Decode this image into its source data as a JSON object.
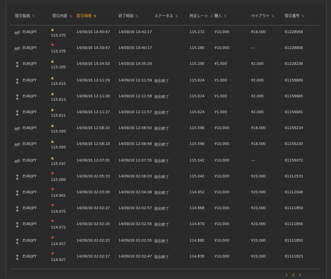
{
  "table": {
    "headers": [
      {
        "label": "取引銘柄",
        "active": false
      },
      {
        "label": "取引内容",
        "active": false
      },
      {
        "label": "取引時間",
        "active": true
      },
      {
        "label": "終了時刻",
        "active": false
      },
      {
        "label": "ステータス",
        "active": false
      },
      {
        "label": "判定レート",
        "active": false
      },
      {
        "label": "購入",
        "active": false
      },
      {
        "label": "ペイアウト",
        "active": false
      },
      {
        "label": "取引番号",
        "active": false
      }
    ],
    "rows": [
      {
        "type": "spread",
        "pair": "EUR/JPY",
        "dir": "up",
        "rate": "115.270",
        "start": "14/09/16 19:40:47",
        "end": "14/09/16 19:41:17",
        "status": "",
        "judge": "115.272",
        "buy": "¥10,000",
        "payout": "¥18,000",
        "id": "61228958"
      },
      {
        "type": "spread",
        "pair": "EUR/JPY",
        "dir": "down",
        "rate": "115.276",
        "start": "14/09/16 19:39:47",
        "end": "14/09/16 19:40:17",
        "status": "",
        "judge": "115.280",
        "buy": "¥10,000",
        "payout": "---",
        "id": "61228808"
      },
      {
        "type": "hourglass",
        "pair": "EUR/JPY",
        "dir": "up",
        "rate": "115.285",
        "start": "14/09/16 19:34:59",
        "end": "14/09/16 19:35:29",
        "status": "",
        "judge": "115.290",
        "buy": "¥1,000",
        "payout": "¥2,000",
        "id": "61228236"
      },
      {
        "type": "hourglass",
        "pair": "EUR/JPY",
        "dir": "up",
        "rate": "115.615",
        "start": "14/09/16 12:11:29",
        "end": "14/09/16 12:11:59",
        "status": "取引終了",
        "judge": "115.624",
        "buy": "¥1,000",
        "payout": "¥2,000",
        "id": "61156689"
      },
      {
        "type": "hourglass",
        "pair": "EUR/JPY",
        "dir": "up",
        "rate": "115.613",
        "start": "14/09/16 12:11:28",
        "end": "14/09/16 12:11:58",
        "status": "取引終了",
        "judge": "115.624",
        "buy": "¥1,000",
        "payout": "¥2,000",
        "id": "61156685"
      },
      {
        "type": "hourglass",
        "pair": "EUR/JPY",
        "dir": "up",
        "rate": "115.611",
        "start": "14/09/16 12:11:27",
        "end": "14/09/16 12:11:57",
        "status": "取引終了",
        "judge": "115.624",
        "buy": "¥1,000",
        "payout": "¥2,000",
        "id": "61156681"
      },
      {
        "type": "spread",
        "pair": "EUR/JPY",
        "dir": "up",
        "rate": "115.583",
        "start": "14/09/16 12:08:20",
        "end": "14/09/16 12:08:50",
        "status": "取引終了",
        "judge": "115.596",
        "buy": "¥10,000",
        "payout": "¥18,000",
        "id": "61156234"
      },
      {
        "type": "spread",
        "pair": "EUR/JPY",
        "dir": "up",
        "rate": "115.583",
        "start": "14/09/16 12:08:18",
        "end": "14/09/16 12:08:48",
        "status": "取引終了",
        "judge": "115.596",
        "buy": "¥10,000",
        "payout": "¥18,000",
        "id": "61156230"
      },
      {
        "type": "spread",
        "pair": "EUR/JPY",
        "dir": "up",
        "rate": "115.547",
        "start": "14/09/16 12:07:05",
        "end": "14/09/16 12:07:35",
        "status": "取引終了",
        "judge": "115.542",
        "buy": "¥10,000",
        "payout": "---",
        "id": "61156072"
      },
      {
        "type": "hourglass",
        "pair": "EUR/JPY",
        "dir": "down",
        "rate": "115.069",
        "start": "14/09/16 02:05:33",
        "end": "14/09/16 02:06:03",
        "status": "取引終了",
        "judge": "115.042",
        "buy": "¥10,000",
        "payout": "¥20,000",
        "id": "61112533"
      },
      {
        "type": "hourglass",
        "pair": "EUR/JPY",
        "dir": "down",
        "rate": "114.961",
        "start": "14/09/16 02:03:38",
        "end": "14/09/16 02:04:08",
        "status": "取引終了",
        "judge": "114.952",
        "buy": "¥10,000",
        "payout": "¥20,000",
        "id": "61112048"
      },
      {
        "type": "hourglass",
        "pair": "EUR/JPY",
        "dir": "down",
        "rate": "114.975",
        "start": "14/09/16 02:02:27",
        "end": "14/09/16 02:02:57",
        "status": "取引終了",
        "judge": "114.868",
        "buy": "¥10,000",
        "payout": "¥20,000",
        "id": "61111859"
      },
      {
        "type": "hourglass",
        "pair": "EUR/JPY",
        "dir": "down",
        "rate": "114.972",
        "start": "14/09/16 02:02:26",
        "end": "14/09/16 02:02:56",
        "status": "取引終了",
        "judge": "114.879",
        "buy": "¥10,000",
        "payout": "¥20,000",
        "id": "61111856"
      },
      {
        "type": "hourglass",
        "pair": "EUR/JPY",
        "dir": "down",
        "rate": "114.957",
        "start": "14/09/16 02:02:25",
        "end": "14/09/16 02:02:55",
        "status": "取引終了",
        "judge": "114.880",
        "buy": "¥10,000",
        "payout": "¥20,000",
        "id": "61111850"
      },
      {
        "type": "hourglass",
        "pair": "EUR/JPY",
        "dir": "down",
        "rate": "114.927",
        "start": "14/09/16 02:02:17",
        "end": "14/09/16 02:02:47",
        "status": "取引終了",
        "judge": "114.838",
        "buy": "¥10,000",
        "payout": "¥20,000",
        "id": "61111823"
      }
    ]
  },
  "pagination": {
    "pages": [
      "1",
      "2",
      "3"
    ],
    "current": "2"
  },
  "colors": {
    "accent": "#f3a21b",
    "up": "#d6c94a",
    "down": "#e04646",
    "background": "#2a2a2a"
  },
  "icons": {
    "spread": "spread-chart-icon",
    "hourglass": "hourglass-icon",
    "up": "up-arrow-icon",
    "down": "down-arrow-icon",
    "sort": "sort-icon"
  }
}
